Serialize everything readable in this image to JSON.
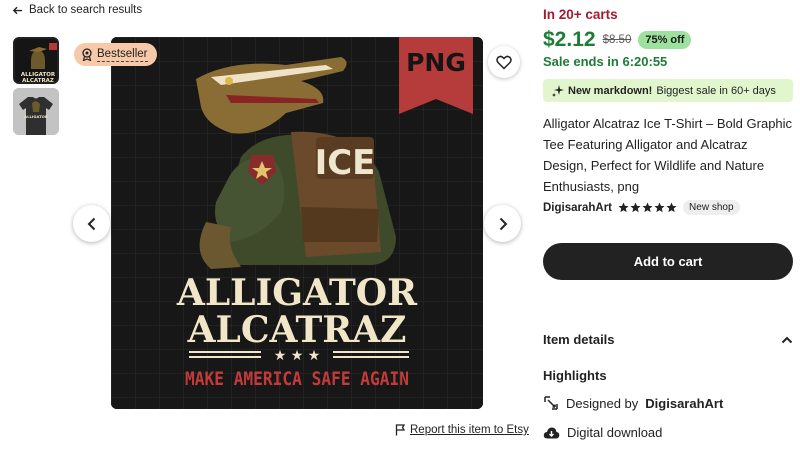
{
  "nav": {
    "back_label": "Back to search results"
  },
  "gallery": {
    "badge": "Bestseller",
    "art": {
      "tag": "PNG",
      "vest_label": "ICE",
      "line1": "ALLIGATOR",
      "line2": "ALCATRAZ",
      "stars": "★ ★ ★",
      "slogan": "MAKE AMERICA SAFE AGAIN"
    },
    "thumb1_text": "ALLIGATOR ALCATRAZ",
    "thumb2_text": "ALLIGATOR ALCATRAZ",
    "report_label": "Report this item to Etsy"
  },
  "listing": {
    "carts_text": "In 20+ carts",
    "price": "$2.12",
    "original_price": "$8.50",
    "discount": "75% off",
    "sale_ends": "Sale ends in 6:20:55",
    "markdown_bold": "New markdown!",
    "markdown_text": "Biggest sale in 60+ days",
    "title": "Alligator Alcatraz Ice T-Shirt – Bold Graphic Tee Featuring Alligator and Alcatraz Design, Perfect for Wildlife and Nature Enthusiasts, png",
    "shop_name": "DigisarahArt",
    "rating": 5,
    "shop_badge": "New shop",
    "add_to_cart": "Add to cart"
  },
  "details": {
    "heading": "Item details",
    "highlights_heading": "Highlights",
    "designed_prefix": "Designed by",
    "designed_by": "DigisarahArt",
    "digital": "Digital download"
  },
  "colors": {
    "price_green": "#1e7c35",
    "carts_red": "#a61a2e",
    "discount_bg": "#9ee09e",
    "markdown_bg": "#e2f6ce",
    "badge_bg": "#f7c9a9",
    "button_dark": "#222222"
  },
  "icons": {
    "back": "arrow-left-icon",
    "badge": "award-icon",
    "heart": "heart-icon",
    "prev": "chevron-left-icon",
    "next": "chevron-right-icon",
    "flag": "flag-icon",
    "markdown": "sparkle-icon",
    "star": "star-icon",
    "collapse": "chevron-up-icon",
    "designed": "design-icon",
    "download": "cloud-download-icon"
  }
}
